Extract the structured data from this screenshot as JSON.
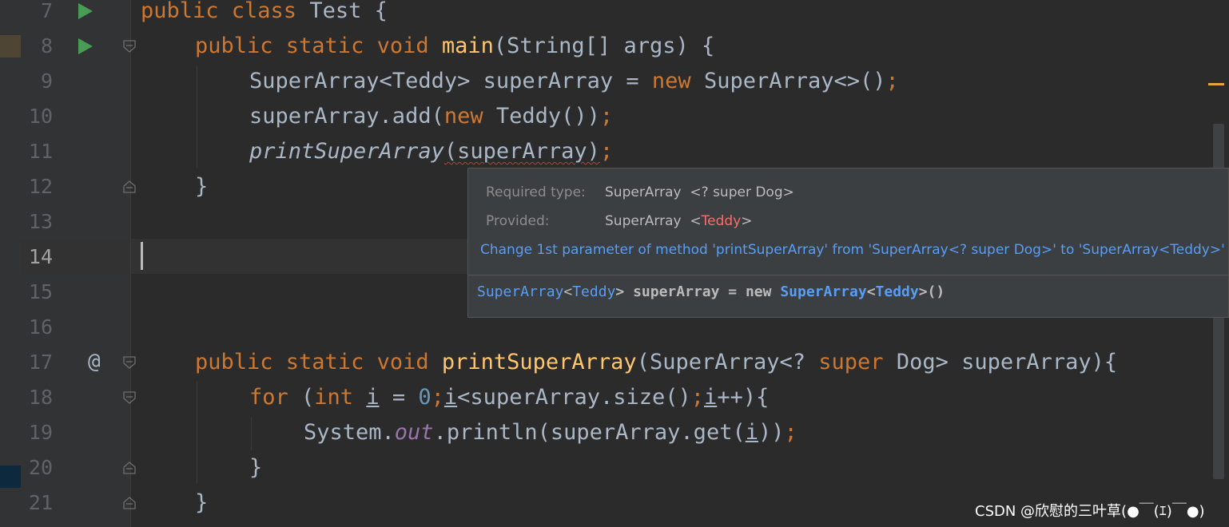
{
  "editor": {
    "line_numbers": [
      "7",
      "8",
      "9",
      "10",
      "11",
      "12",
      "13",
      "14",
      "15",
      "16",
      "17",
      "18",
      "19",
      "20",
      "21"
    ],
    "current_line": "14",
    "gutter_run_icons": [
      "run-icon",
      "run-icon"
    ],
    "gutter_override_marker": "@",
    "code": {
      "l7": [
        "public class ",
        "Test {"
      ],
      "l8": [
        "public static void ",
        "main",
        "(String[] args) {"
      ],
      "l9": [
        "SuperArray<Teddy> superArray = ",
        "new ",
        "SuperArray<>()",
        ";"
      ],
      "l10": [
        "superArray.add(",
        "new ",
        "Teddy())",
        ";"
      ],
      "l11": [
        "printSuperArray",
        "(superArray)",
        ";"
      ],
      "l12": [
        "}"
      ],
      "l17": [
        "public static void ",
        "printSuperArray",
        "(SuperArray<? ",
        "super ",
        "Dog> superArray){"
      ],
      "l18": [
        "for ",
        "(",
        "int ",
        "i",
        " = ",
        "0",
        ";",
        "i",
        "<superArray.size()",
        ";",
        "i",
        "++){"
      ],
      "l19": [
        "System.",
        "out",
        ".println(superArray.get(",
        "i",
        "))",
        ";"
      ],
      "l20": [
        "}"
      ],
      "l21": [
        "}"
      ]
    }
  },
  "tooltip": {
    "required_label": "Required type:",
    "required_value": "SuperArray  <? super Dog>",
    "provided_label": "Provided:",
    "provided_prefix": "SuperArray  <",
    "provided_type": "Teddy",
    "provided_suffix": ">",
    "quick_fix": "Change 1st parameter of method 'printSuperArray' from 'SuperArray<? super Dog>' to 'SuperArray<Teddy>'",
    "declaration": [
      "SuperArray",
      "<",
      "Teddy",
      "> superArray = new ",
      "SuperArray",
      "<",
      "Teddy",
      ">()"
    ]
  },
  "watermark": "CSDN @欣慰的三叶草(●￣(ｴ)￣●)",
  "colors": {
    "background": "#2b2b2b",
    "gutter": "#313335",
    "keyword": "#cc7832",
    "method_decl": "#ffc66d",
    "number": "#6897bb",
    "static_field": "#9876aa",
    "text": "#a9b7c6",
    "error_underline": "#bc3f3c",
    "link": "#589df6"
  }
}
